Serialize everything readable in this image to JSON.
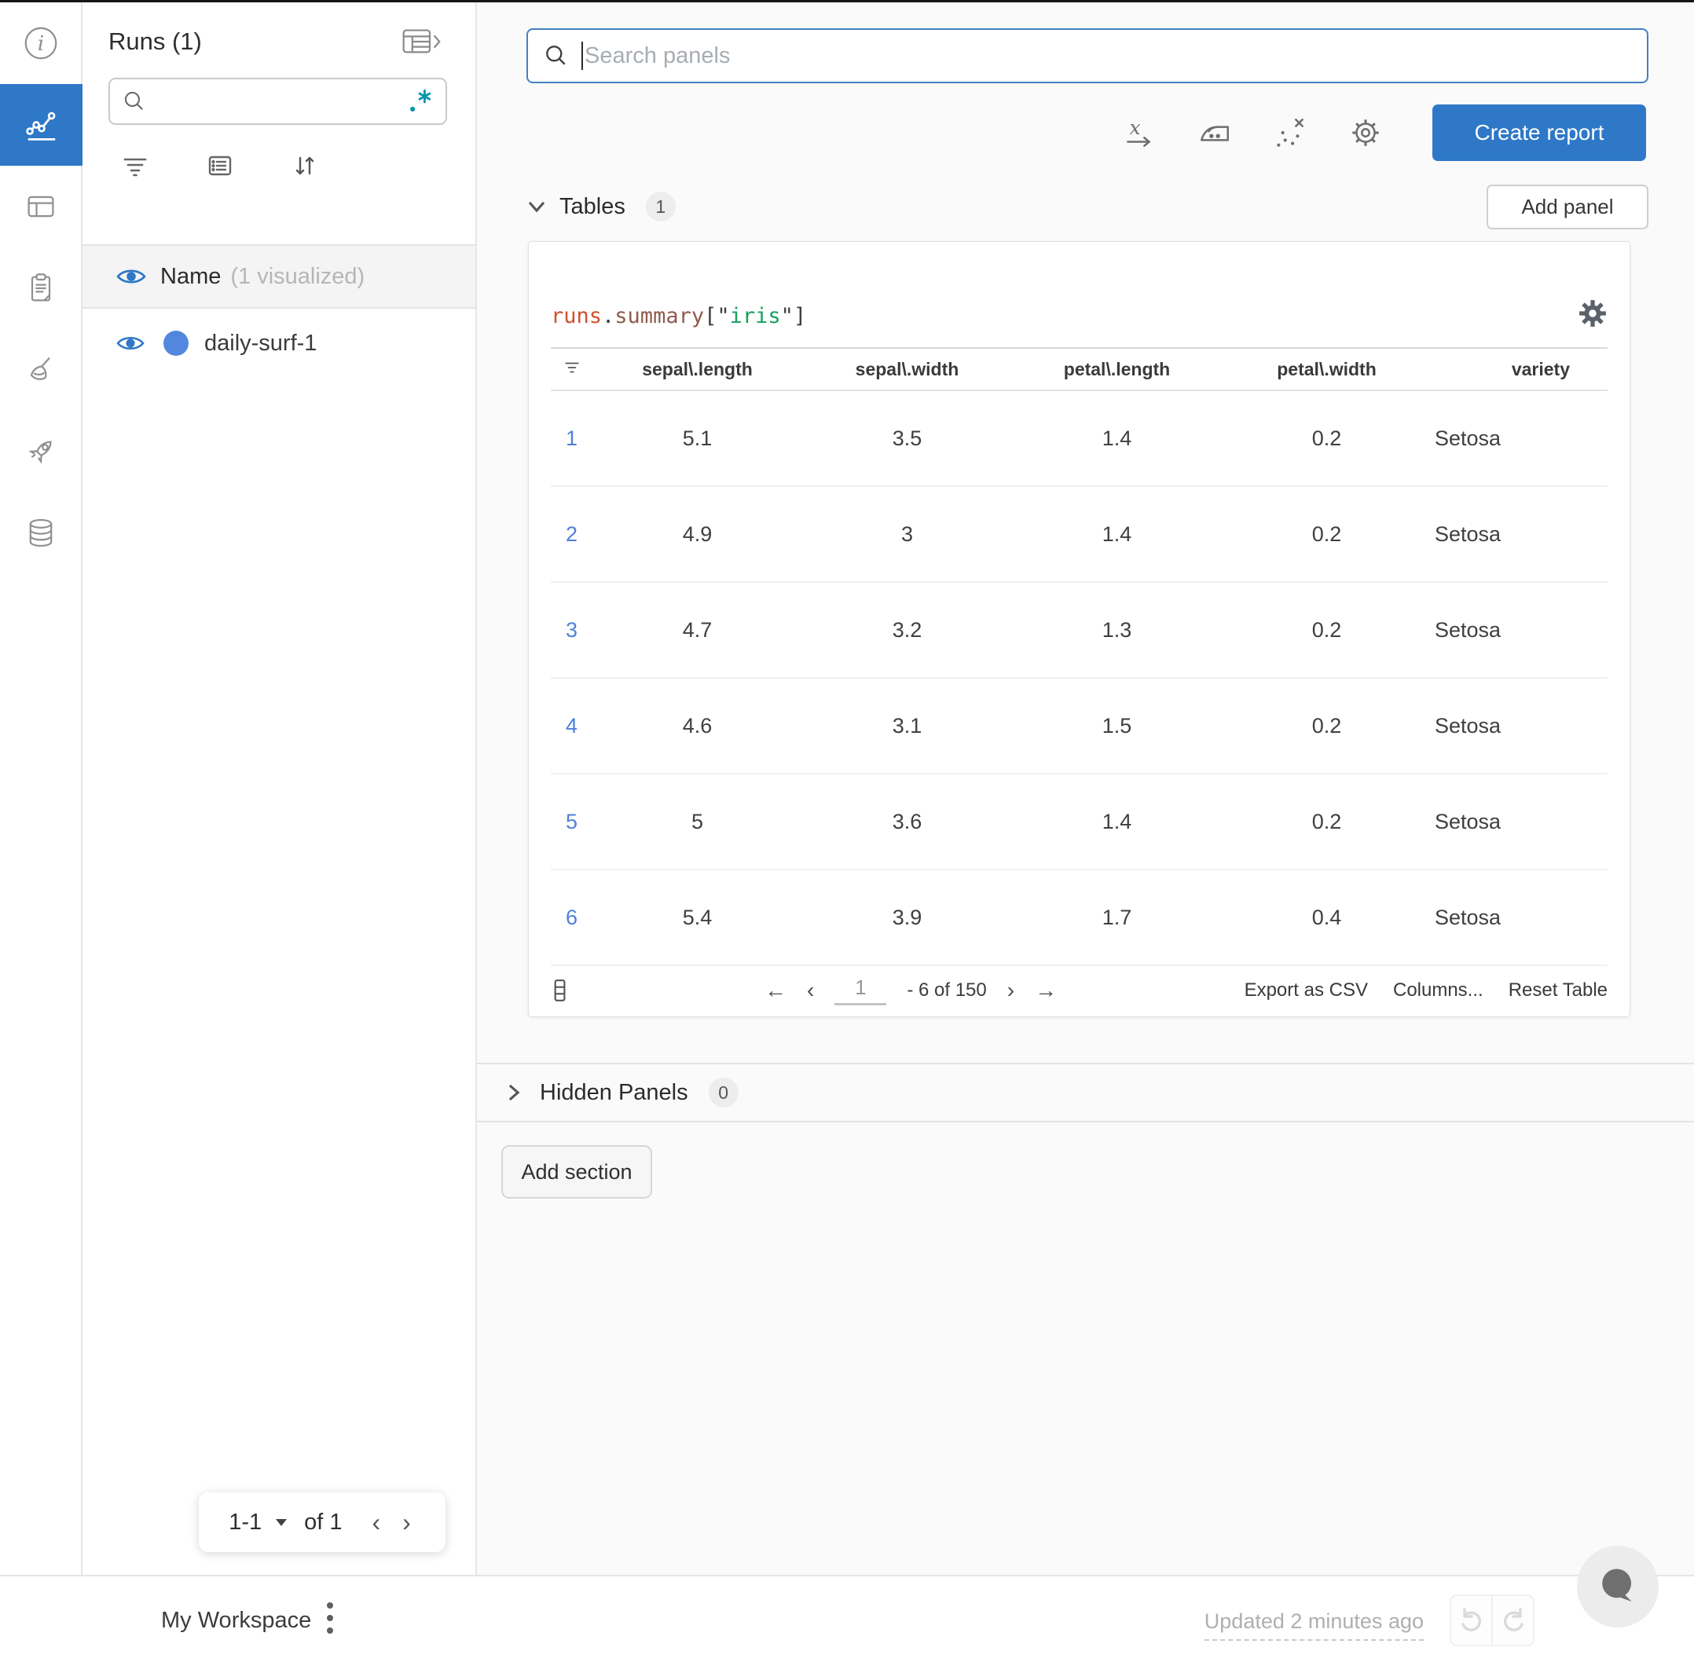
{
  "colors": {
    "accent_blue": "#2e78c7",
    "run_dot_blue": "#5387dd",
    "regex_teal": "#0097ab",
    "row_index_blue": "#4e80d9",
    "syntax_runs": "#d0502e",
    "syntax_summary": "#8d5b4c",
    "syntax_string_green": "#17a05d"
  },
  "left_rail": {
    "items": [
      {
        "icon": "info"
      },
      {
        "icon": "line-chart",
        "active": true
      },
      {
        "icon": "panels"
      },
      {
        "icon": "notes"
      },
      {
        "icon": "sweep-broom"
      },
      {
        "icon": "launch-rocket"
      },
      {
        "icon": "artifacts-database"
      }
    ]
  },
  "sidebar": {
    "title": "Runs (1)",
    "search_value": "",
    "list_header": {
      "label": "Name",
      "annotation": "(1 visualized)"
    },
    "runs": [
      {
        "name": "daily-surf-1"
      }
    ],
    "pagination": {
      "range": "1-1",
      "total": "of 1",
      "prev": "‹",
      "next": "›"
    }
  },
  "topbar": {
    "search_placeholder": "Search panels",
    "create_report": "Create report"
  },
  "sections": {
    "tables_label": "Tables",
    "tables_count": "1",
    "add_panel": "Add panel",
    "hidden_label": "Hidden Panels",
    "hidden_count": "0",
    "add_section": "Add section"
  },
  "table_panel": {
    "title": {
      "runs": "runs",
      "dot": ".",
      "summary": "summary",
      "bracket_open": "[\"",
      "key": "iris",
      "bracket_close": "\"]"
    },
    "columns": [
      "sepal\\.length",
      "sepal\\.width",
      "petal\\.length",
      "petal\\.width",
      "variety"
    ],
    "rows": [
      {
        "index": "1",
        "values": [
          "5.1",
          "3.5",
          "1.4",
          "0.2",
          "Setosa"
        ]
      },
      {
        "index": "2",
        "values": [
          "4.9",
          "3",
          "1.4",
          "0.2",
          "Setosa"
        ]
      },
      {
        "index": "3",
        "values": [
          "4.7",
          "3.2",
          "1.3",
          "0.2",
          "Setosa"
        ]
      },
      {
        "index": "4",
        "values": [
          "4.6",
          "3.1",
          "1.5",
          "0.2",
          "Setosa"
        ]
      },
      {
        "index": "5",
        "values": [
          "5",
          "3.6",
          "1.4",
          "0.2",
          "Setosa"
        ]
      },
      {
        "index": "6",
        "values": [
          "5.4",
          "3.9",
          "1.7",
          "0.4",
          "Setosa"
        ]
      }
    ],
    "footer": {
      "first": "←",
      "prev": "‹",
      "page_value": "1",
      "range_label": "- 6 of 150",
      "next": "›",
      "last": "→",
      "export_csv": "Export as CSV",
      "columns": "Columns...",
      "reset": "Reset Table"
    }
  },
  "bottom_bar": {
    "workspace": "My Workspace",
    "updated": "Updated 2 minutes ago"
  }
}
